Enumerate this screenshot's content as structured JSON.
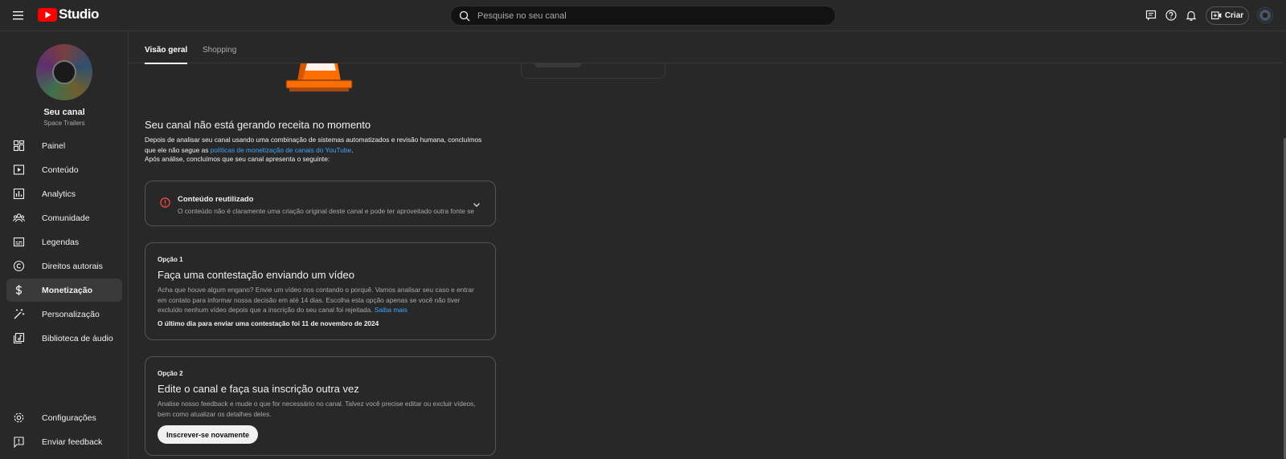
{
  "header": {
    "logo_text": "Studio",
    "search_placeholder": "Pesquise no seu canal",
    "create_label": "Criar",
    "icons": [
      "menu-icon",
      "youtube-logo-icon",
      "search-icon",
      "comment-icon",
      "help-icon",
      "bell-icon",
      "create-video-icon"
    ]
  },
  "sidebar": {
    "channel_name": "Seu canal",
    "channel_subtitle": "Space Trailers",
    "items": [
      {
        "label": "Painel",
        "icon": "dashboard-icon"
      },
      {
        "label": "Conteúdo",
        "icon": "content-icon"
      },
      {
        "label": "Analytics",
        "icon": "analytics-icon"
      },
      {
        "label": "Comunidade",
        "icon": "community-icon"
      },
      {
        "label": "Legendas",
        "icon": "subtitles-icon"
      },
      {
        "label": "Direitos autorais",
        "icon": "copyright-icon"
      },
      {
        "label": "Monetização",
        "icon": "dollar-icon",
        "active": true
      },
      {
        "label": "Personalização",
        "icon": "magic-wand-icon"
      },
      {
        "label": "Biblioteca de áudio",
        "icon": "audio-library-icon"
      }
    ],
    "bottom_items": [
      {
        "label": "Configurações",
        "icon": "gear-icon"
      },
      {
        "label": "Enviar feedback",
        "icon": "feedback-icon"
      }
    ]
  },
  "tabs": [
    {
      "label": "Visão geral",
      "active": true
    },
    {
      "label": "Shopping",
      "active": false
    }
  ],
  "main": {
    "heading": "Seu canal não está gerando receita no momento",
    "para_before_link": "Depois de analisar seu canal usando uma combinação de sistemas automatizados e revisão humana, concluímos que ele não segue as ",
    "para_link": "políticas de monetização de canais do YouTube",
    "para_after_link": ".",
    "para2": "Após análise, concluímos que seu canal apresenta o seguinte:",
    "reused": {
      "title": "Conteúdo reutilizado",
      "description": "O conteúdo não é claramente uma criação original deste canal e pode ter aproveitado outra fonte se"
    },
    "option1": {
      "label": "Opção 1",
      "title": "Faça uma contestação enviando um vídeo",
      "description": "Acha que houve algum engano? Envie um vídeo nos contando o porquê. Vamos analisar seu caso e entrar em contato para informar nossa decisão em até 14 dias. Escolha esta opção apenas se você não tiver excluído nenhum vídeo depois que a inscrição do seu canal foi rejeitada. ",
      "link": "Saiba mais",
      "note": "O último dia para enviar uma contestação foi 11 de novembro de 2024"
    },
    "option2": {
      "label": "Opção 2",
      "title": "Edite o canal e faça sua inscrição outra vez",
      "description": "Analise nosso feedback e mude o que for necessário no canal. Talvez você precise editar ou excluir vídeos, bem como atualizar os detalhes deles.",
      "button": "Inscrever-se novamente"
    }
  },
  "colors": {
    "background": "#282828",
    "link": "#3ea6ff",
    "warning": "#ff4e45",
    "brand_red": "#ff0000",
    "cone_orange": "#ff6d00"
  }
}
